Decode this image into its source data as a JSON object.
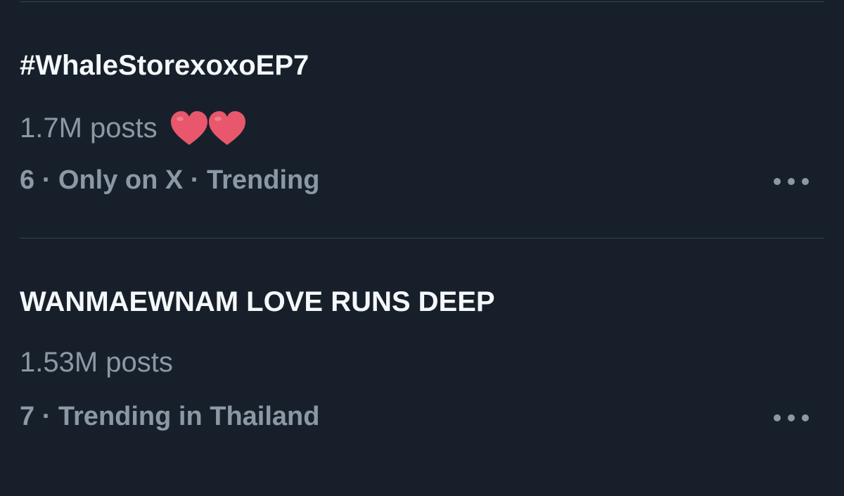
{
  "trends": [
    {
      "name": "#WhaleStorexoxoEP7",
      "posts": "1.7M posts",
      "meta": "6 · Only on X · Trending",
      "has_hearts": true,
      "more_icon": "more-horizontal-icon"
    },
    {
      "name": "WANMAEWNAM LOVE RUNS DEEP",
      "posts": "1.53M posts",
      "meta": "7 · Trending in Thailand",
      "has_hearts": false,
      "more_icon": "more-horizontal-icon"
    }
  ],
  "colors": {
    "background": "#17202a",
    "primary_text": "#f5f8fa",
    "secondary_text": "#8b98a5",
    "divider": "#38444d",
    "heart": "#e8576b"
  }
}
